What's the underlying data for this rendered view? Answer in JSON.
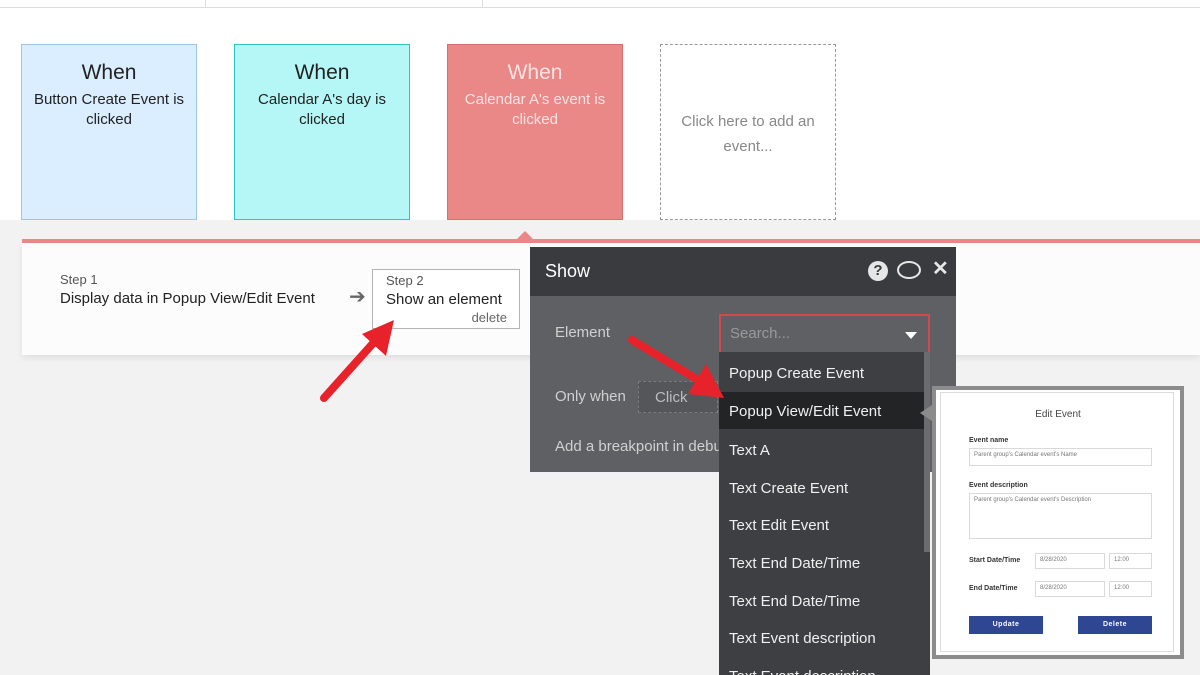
{
  "events": [
    {
      "when": "When",
      "desc": "Button Create Event is clicked"
    },
    {
      "when": "When",
      "desc": "Calendar A's day is clicked"
    },
    {
      "when": "When",
      "desc": "Calendar A's event is clicked"
    }
  ],
  "add_event": "Click here to add an event...",
  "steps": [
    {
      "label": "Step 1",
      "title": "Display data in Popup View/Edit Event"
    },
    {
      "label": "Step 2",
      "title": "Show an element",
      "delete": "delete"
    }
  ],
  "dialog": {
    "title": "Show",
    "element_label": "Element",
    "search_placeholder": "Search...",
    "only_when_label": "Only when",
    "only_when_value": "Click",
    "breakpoint_label": "Add a breakpoint in debug mode"
  },
  "dropdown_items": [
    "Popup Create Event",
    "Popup View/Edit Event",
    "Text A",
    "Text Create Event",
    "Text Edit Event",
    "Text End Date/Time",
    "Text End Date/Time",
    "Text Event description",
    "Text Event description"
  ],
  "dropdown_selected_index": 1,
  "preview": {
    "title": "Edit Event",
    "event_name_label": "Event name",
    "event_name_value": "Parent group's Calendar event's Name",
    "event_desc_label": "Event description",
    "event_desc_value": "Parent group's Calendar event's Description",
    "start_label": "Start Date/Time",
    "start_date": "8/28/2020",
    "start_time": "12:00",
    "end_label": "End Date/Time",
    "end_date": "8/28/2020",
    "end_time": "12:00",
    "update_label": "Update",
    "delete_label": "Delete"
  },
  "colors": {
    "accent_red": "#e98887",
    "arrow_red": "#e8222a",
    "dialog_bg": "#5f6063",
    "button_blue": "#2f4693"
  }
}
